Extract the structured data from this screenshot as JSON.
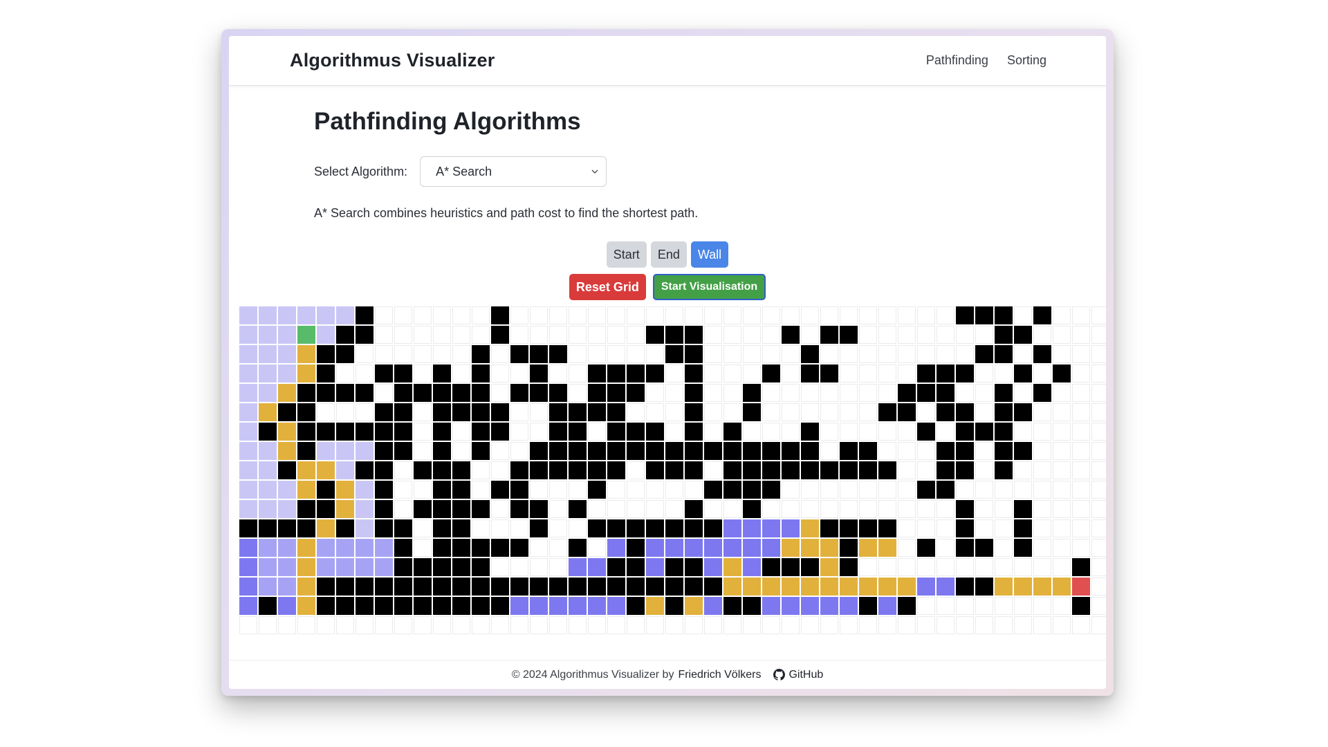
{
  "navbar": {
    "brand": "Algorithmus Visualizer",
    "links": [
      "Pathfinding",
      "Sorting"
    ]
  },
  "main": {
    "title": "Pathfinding Algorithms",
    "select_label": "Select Algorithm:",
    "select_value": "A* Search",
    "description": "A* Search combines heuristics and path cost to find the shortest path."
  },
  "modes": {
    "start": "Start",
    "end": "End",
    "wall": "Wall",
    "active": "Wall"
  },
  "actions": {
    "reset": "Reset Grid",
    "start": "Start Visualisation"
  },
  "grid": {
    "cols": 45,
    "rows": 17,
    "legend": {
      ".": "empty",
      "#": "wall",
      "a": "visited-light",
      "b": "visited-medium",
      "c": "visited-dark",
      "p": "path",
      "S": "start",
      "E": "end"
    },
    "rows_data": [
      "aaaaaa#......#.......................###.#...",
      "aaaSa##......#.......###....#.##.......##...",
      "aaap##......#.###.....##.....#........##.#..",
      "aaap#..##.#.#..#..####.#...#.##....###..#.#.",
      "aap####.#####.###.###..#..#.......###..#.#..",
      "ap##...##.####..####...#..#......##.##.##...",
      "a#p######.#.##..##.###.#.#...#.....#.###....",
      "aap#aaa##.#.#..###############.##...##.##...",
      "aa#ppa##.###..######.###.#########..##.#....",
      "aaap#pa#..##.##...#.....####.......##.......",
      "aaa##pa#.####.##.#.....#..#..........#..#...",
      "####p#a##.##...#..#######ccccp####...#..#...",
      "cbbpbbbb#.#####..#.c#cccccccppp#pp.#.##.#...",
      "cbbpbbbb#####....cc##c##cpc###p#...........#",
      "cbbp#####################ppppppppppcc##ppppE.#...",
      "c#cp##########cccccc#p#pc##ccccc#c#........#...",
      "....................................................."
    ]
  },
  "footer": {
    "copyright": "© 2024 Algorithmus Visualizer by",
    "author": "Friedrich Völkers",
    "github": "GitHub"
  }
}
